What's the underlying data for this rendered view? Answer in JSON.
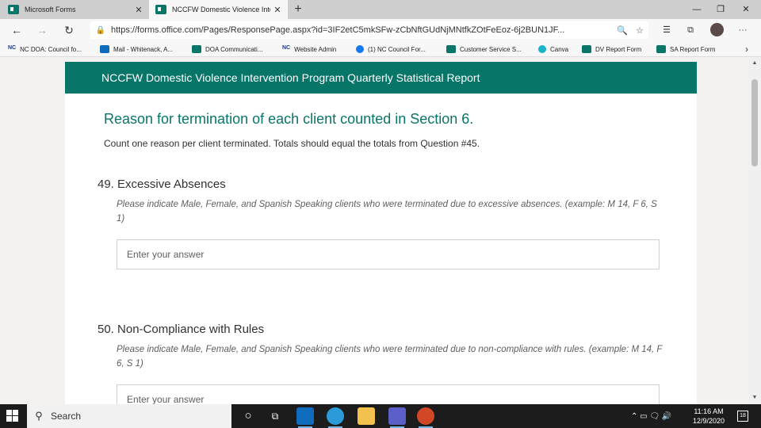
{
  "browser": {
    "tabs": [
      {
        "title": "Microsoft Forms",
        "close": "✕"
      },
      {
        "title": "NCCFW Domestic Violence Inter",
        "close": "✕"
      }
    ],
    "new_tab": "+",
    "window_controls": {
      "minimize": "—",
      "maximize": "❐",
      "close": "✕"
    },
    "nav": {
      "back": "←",
      "forward": "→",
      "refresh": "↻"
    },
    "url": "https://forms.office.com/Pages/ResponsePage.aspx?id=3IF2etC5mkSFw-zCbNftGUdNjMNtfkZOtFeEoz-6j2BUN1JF...",
    "lock": "🔒",
    "url_actions": {
      "zoom": "🔍",
      "favorite": "☆"
    },
    "toolbar": {
      "favorites": "☰",
      "collections": "⧉",
      "more": "···"
    },
    "favorites": [
      {
        "label": "NC DOA: Council fo...",
        "icon": "nc-icon",
        "icon_text": "NC"
      },
      {
        "label": "Mail - Whitenack, A...",
        "icon": "outlook-icon"
      },
      {
        "label": "DOA Communicati...",
        "icon": "forms-icon"
      },
      {
        "label": "Website Admin",
        "icon": "nc-icon",
        "icon_text": "NC"
      },
      {
        "label": "(1) NC Council For...",
        "icon": "facebook-icon"
      },
      {
        "label": "Customer Service S...",
        "icon": "forms-icon"
      },
      {
        "label": "Canva",
        "icon": "canva-icon"
      },
      {
        "label": "DV Report Form",
        "icon": "forms-icon"
      },
      {
        "label": "SA Report Form",
        "icon": "forms-icon"
      }
    ],
    "favorites_more": "›"
  },
  "form": {
    "header_title": "NCCFW Domestic Violence Intervention Program Quarterly Statistical Report",
    "section_title": "Reason for termination of each client counted in Section 6.",
    "section_desc": "Count one reason per client terminated. Totals should equal the totals from Question #45.",
    "questions": [
      {
        "number": "49.",
        "title": "Excessive Absences",
        "desc": "Please indicate Male, Female, and Spanish Speaking clients who were terminated due to excessive absences. (example: M 14, F 6, S 1)",
        "placeholder": "Enter your answer",
        "value": ""
      },
      {
        "number": "50.",
        "title": "Non-Compliance with Rules",
        "desc": "Please indicate Male, Female, and Spanish Speaking clients who were terminated due to non-compliance with rules. (example: M 14, F 6, S 1)",
        "placeholder": "Enter your answer",
        "value": ""
      }
    ]
  },
  "scrollbar": {
    "up": "▲",
    "down": "▼"
  },
  "taskbar": {
    "search_label": "Search",
    "search_icon": "⚲",
    "apps": [
      {
        "name": "cortana",
        "icon": "○"
      },
      {
        "name": "task-view",
        "icon": "⧉"
      },
      {
        "name": "outlook",
        "color": "#0f6cbd"
      },
      {
        "name": "edge",
        "color": "#2a9bd8"
      },
      {
        "name": "file-explorer",
        "color": "#f2c14e"
      },
      {
        "name": "teams",
        "color": "#5b5fc7"
      },
      {
        "name": "powerpoint",
        "color": "#d24726"
      }
    ],
    "tray_icons": "⌃ ▭ 🗨 🔊",
    "time": "11:16 AM",
    "date": "12/9/2020",
    "notifications": "18"
  }
}
